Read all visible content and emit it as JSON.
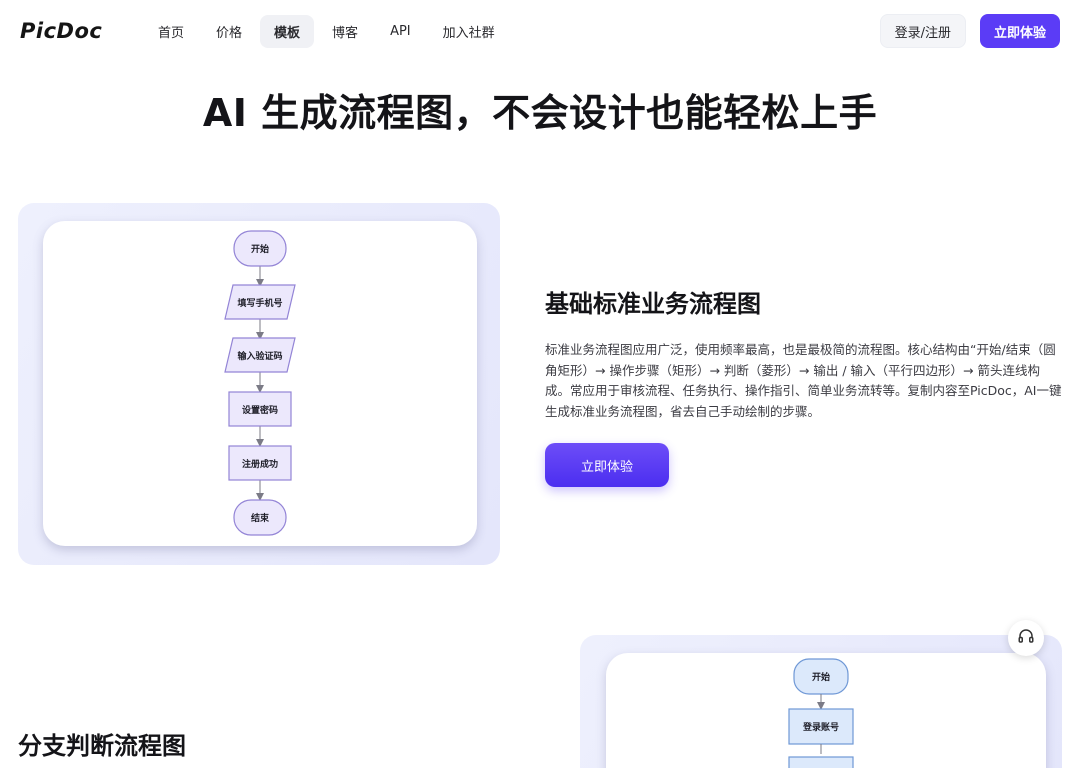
{
  "brand": {
    "logo": "PicDoc"
  },
  "nav": {
    "items": [
      {
        "label": "首页"
      },
      {
        "label": "价格"
      },
      {
        "label": "模板",
        "active": true
      },
      {
        "label": "博客"
      },
      {
        "label": "API"
      },
      {
        "label": "加入社群"
      }
    ]
  },
  "actions": {
    "login": "登录/注册",
    "try": "立即体验"
  },
  "hero": {
    "title": "AI 生成流程图，不会设计也能轻松上手"
  },
  "section1": {
    "title": "基础标准业务流程图",
    "description": "标准业务流程图应用广泛，使用频率最高，也是最极简的流程图。核心结构由“开始/结束（圆角矩形）→ 操作步骤（矩形）→ 判断（菱形）→ 输出 / 输入（平行四边形）→ 箭头连线构成。常应用于审核流程、任务执行、操作指引、简单业务流转等。复制内容至PicDoc，AI一键生成标准业务流程图，省去自己手动绘制的步骤。",
    "button": "立即体验",
    "flowchart": {
      "nodes": [
        {
          "label": "开始",
          "shape": "terminal"
        },
        {
          "label": "填写手机号",
          "shape": "parallelogram"
        },
        {
          "label": "输入验证码",
          "shape": "parallelogram"
        },
        {
          "label": "设置密码",
          "shape": "rect"
        },
        {
          "label": "注册成功",
          "shape": "rect"
        },
        {
          "label": "结束",
          "shape": "terminal"
        }
      ],
      "colors": {
        "fill": "#ece8fc",
        "stroke": "#9384d6",
        "arrow": "#7b7b86"
      }
    }
  },
  "section2": {
    "title": "分支判断流程图",
    "flowchart": {
      "nodes": [
        {
          "label": "开始",
          "shape": "terminal"
        },
        {
          "label": "登录账号",
          "shape": "rect"
        }
      ],
      "colors": {
        "fill": "#dce9fb",
        "stroke": "#6f98d6",
        "arrow": "#7b7b86"
      }
    }
  },
  "icons": {
    "support": "headset-icon"
  }
}
